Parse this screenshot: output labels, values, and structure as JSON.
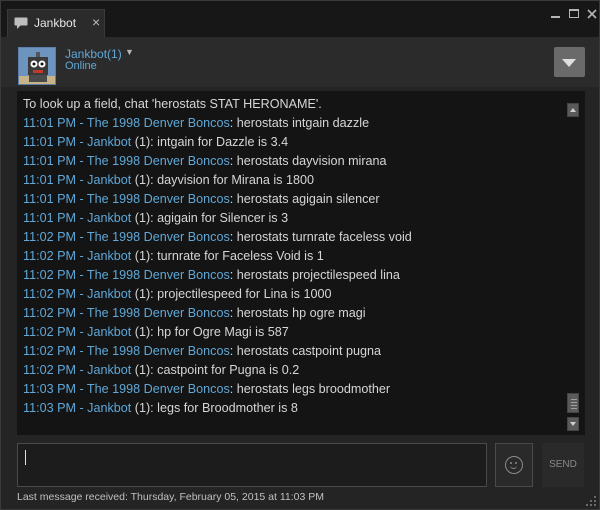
{
  "window": {
    "tab_label": "Jankbot",
    "tab_close": "×"
  },
  "friend": {
    "name": "Jankbot(1)",
    "caret": "▼",
    "status": "Online"
  },
  "chat": {
    "intro": "To look up a field, chat 'herostats STAT HERONAME'.",
    "messages": [
      {
        "meta": "11:01 PM - The 1998 Denver Boncos",
        "sep": ": ",
        "extra": "",
        "text": "herostats intgain dazzle"
      },
      {
        "meta": "11:01 PM - Jankbot",
        "extra": " (1)",
        "sep": ": ",
        "text": "intgain for Dazzle is 3.4"
      },
      {
        "meta": "11:01 PM - The 1998 Denver Boncos",
        "extra": "",
        "sep": ": ",
        "text": "herostats dayvision mirana"
      },
      {
        "meta": "11:01 PM - Jankbot",
        "extra": " (1)",
        "sep": ": ",
        "text": "dayvision for Mirana is 1800"
      },
      {
        "meta": "11:01 PM - The 1998 Denver Boncos",
        "extra": "",
        "sep": ": ",
        "text": "herostats agigain silencer"
      },
      {
        "meta": "11:01 PM - Jankbot",
        "extra": " (1)",
        "sep": ": ",
        "text": "agigain for Silencer is 3"
      },
      {
        "meta": "11:02 PM - The 1998 Denver Boncos",
        "extra": "",
        "sep": ": ",
        "text": "herostats turnrate faceless void"
      },
      {
        "meta": "11:02 PM - Jankbot",
        "extra": " (1)",
        "sep": ": ",
        "text": "turnrate for Faceless Void is 1"
      },
      {
        "meta": "11:02 PM - The 1998 Denver Boncos",
        "extra": "",
        "sep": ": ",
        "text": "herostats projectilespeed lina"
      },
      {
        "meta": "11:02 PM - Jankbot",
        "extra": " (1)",
        "sep": ": ",
        "text": "projectilespeed for Lina is 1000"
      },
      {
        "meta": "11:02 PM - The 1998 Denver Boncos",
        "extra": "",
        "sep": ": ",
        "text": "herostats hp ogre magi"
      },
      {
        "meta": "11:02 PM - Jankbot",
        "extra": " (1)",
        "sep": ": ",
        "text": "hp for Ogre Magi is 587"
      },
      {
        "meta": "11:02 PM - The 1998 Denver Boncos",
        "extra": "",
        "sep": ": ",
        "text": "herostats castpoint pugna"
      },
      {
        "meta": "11:02 PM - Jankbot",
        "extra": " (1)",
        "sep": ": ",
        "text": "castpoint for Pugna is 0.2"
      },
      {
        "meta": "11:03 PM - The 1998 Denver Boncos",
        "extra": "",
        "sep": ": ",
        "text": "herostats legs broodmother"
      },
      {
        "meta": "11:03 PM - Jankbot",
        "extra": " (1)",
        "sep": ": ",
        "text": "legs for Broodmother is 8"
      }
    ]
  },
  "composer": {
    "value": "",
    "send_label": "SEND"
  },
  "footer": {
    "last_message": "Last message received: Thursday, February 05, 2015 at 11:03 PM"
  },
  "colors": {
    "link": "#5fa8d8",
    "background": "#242424",
    "log_background": "#141414"
  },
  "icons": {
    "tab": "chat-bubble-icon",
    "menu": "dropdown-triangle-icon",
    "emoticon": "smiley-icon"
  }
}
